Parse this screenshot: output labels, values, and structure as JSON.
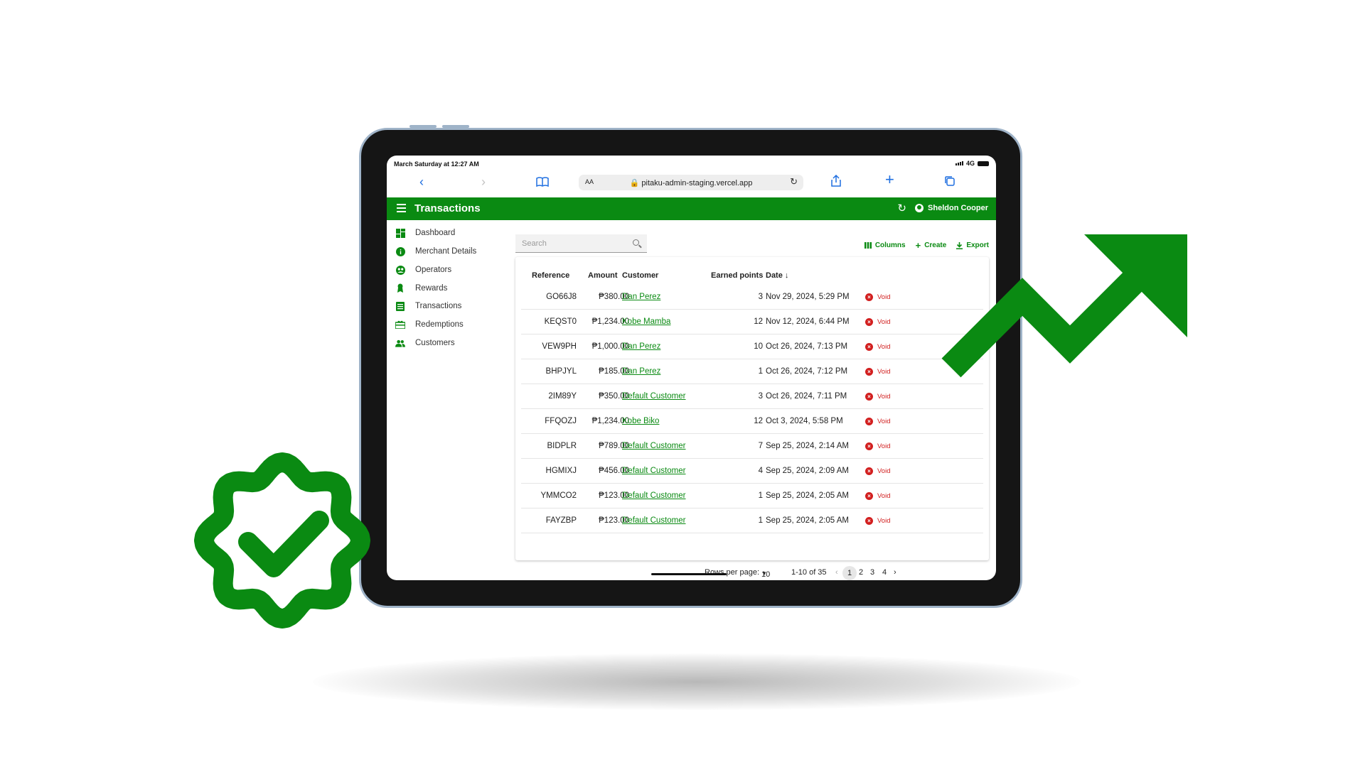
{
  "status": {
    "time": "March Saturday at 12:27 AM",
    "network": "4G"
  },
  "browser": {
    "text_size": "AA",
    "url": "pitaku-admin-staging.vercel.app"
  },
  "app": {
    "title": "Transactions",
    "user": "Sheldon Cooper",
    "accent": "#0a8a12"
  },
  "sidebar": {
    "items": [
      {
        "label": "Dashboard",
        "icon": "dashboard-icon"
      },
      {
        "label": "Merchant Details",
        "icon": "info-icon"
      },
      {
        "label": "Operators",
        "icon": "operators-icon"
      },
      {
        "label": "Rewards",
        "icon": "award-icon"
      },
      {
        "label": "Transactions",
        "icon": "list-icon"
      },
      {
        "label": "Redemptions",
        "icon": "redeem-icon"
      },
      {
        "label": "Customers",
        "icon": "people-icon"
      }
    ]
  },
  "search": {
    "placeholder": "Search"
  },
  "toolbar": {
    "columns": "Columns",
    "create": "Create",
    "export": "Export"
  },
  "table": {
    "headers": {
      "reference": "Reference",
      "amount": "Amount",
      "customer": "Customer",
      "points": "Earned points",
      "date": "Date"
    },
    "void_label": "Void",
    "rows": [
      {
        "ref": "GO66J8",
        "amount": "₱380.00",
        "customer": "Dan Perez",
        "points": "3",
        "date": "Nov 29, 2024, 5:29 PM"
      },
      {
        "ref": "KEQST0",
        "amount": "₱1,234.00",
        "customer": "Kobe Mamba",
        "points": "12",
        "date": "Nov 12, 2024, 6:44 PM"
      },
      {
        "ref": "VEW9PH",
        "amount": "₱1,000.00",
        "customer": "Dan Perez",
        "points": "10",
        "date": "Oct 26, 2024, 7:13 PM"
      },
      {
        "ref": "BHPJYL",
        "amount": "₱185.00",
        "customer": "Dan Perez",
        "points": "1",
        "date": "Oct 26, 2024, 7:12 PM"
      },
      {
        "ref": "2IM89Y",
        "amount": "₱350.00",
        "customer": "Default Customer",
        "points": "3",
        "date": "Oct 26, 2024, 7:11 PM"
      },
      {
        "ref": "FFQOZJ",
        "amount": "₱1,234.00",
        "customer": "Kobe Biko",
        "points": "12",
        "date": "Oct 3, 2024, 5:58 PM"
      },
      {
        "ref": "BIDPLR",
        "amount": "₱789.00",
        "customer": "Default Customer",
        "points": "7",
        "date": "Sep 25, 2024, 2:14 AM"
      },
      {
        "ref": "HGMIXJ",
        "amount": "₱456.00",
        "customer": "Default Customer",
        "points": "4",
        "date": "Sep 25, 2024, 2:09 AM"
      },
      {
        "ref": "YMMCO2",
        "amount": "₱123.00",
        "customer": "Default Customer",
        "points": "1",
        "date": "Sep 25, 2024, 2:05 AM"
      },
      {
        "ref": "FAYZBP",
        "amount": "₱123.00",
        "customer": "Default Customer",
        "points": "1",
        "date": "Sep 25, 2024, 2:05 AM"
      }
    ]
  },
  "pager": {
    "rows_label": "Rows per page:",
    "rows_value": "10",
    "range": "1-10 of 35",
    "pages": [
      "1",
      "2",
      "3",
      "4"
    ]
  },
  "decor": {
    "badge_icon": "verified-badge-icon",
    "trend_icon": "trending-up-arrow-icon"
  }
}
